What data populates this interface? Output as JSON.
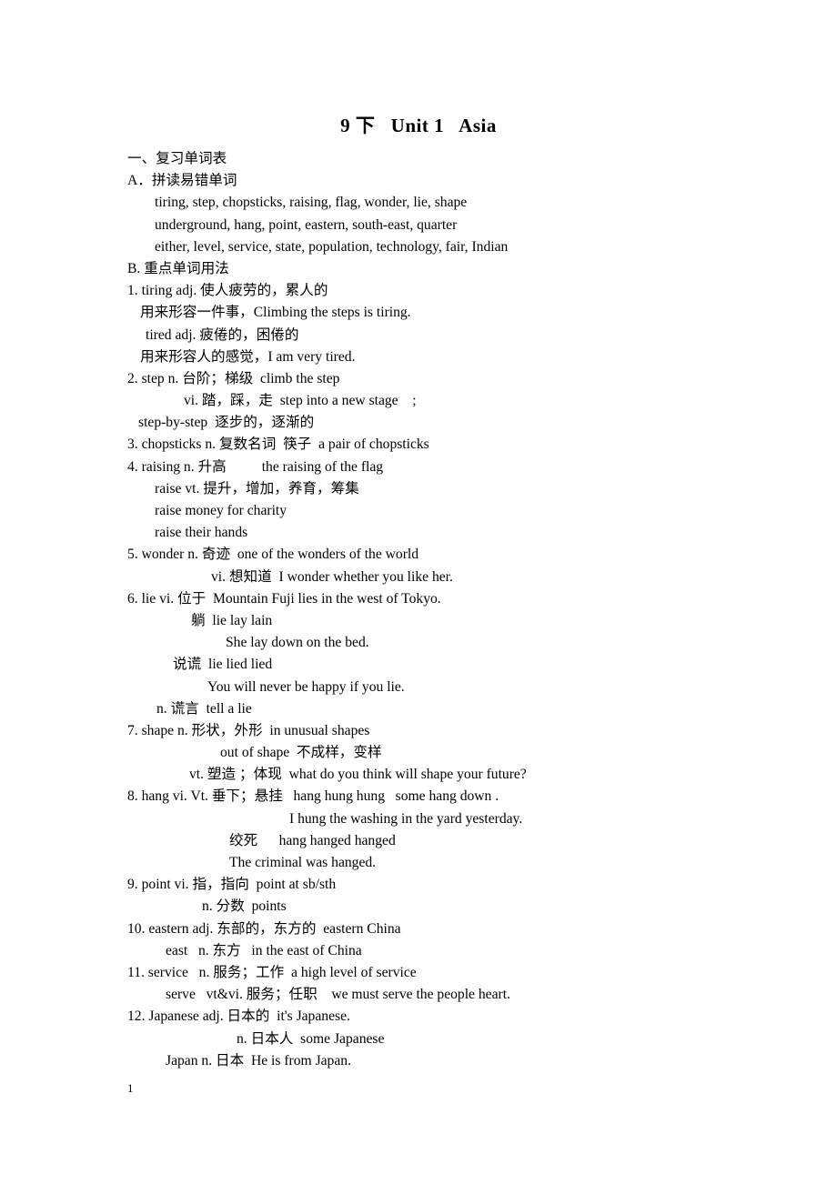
{
  "document": {
    "title": "9 下   Unit 1   Asia",
    "page_number": "1",
    "sections": [
      {
        "indent": 0,
        "text": "一、复习单词表"
      },
      {
        "indent": 0,
        "text": "A．拼读易错单词"
      },
      {
        "indent": 30,
        "text": "tiring, step, chopsticks, raising, flag, wonder, lie, shape"
      },
      {
        "indent": 30,
        "text": "underground, hang, point, eastern, south-east, quarter"
      },
      {
        "indent": 30,
        "text": "either, level, service, state, population, technology, fair, Indian"
      },
      {
        "indent": 0,
        "text": "B. 重点单词用法"
      },
      {
        "indent": 0,
        "text": "1. tiring adj. 使人疲劳的，累人的"
      },
      {
        "indent": 14,
        "text": "用来形容一件事，Climbing the steps is tiring."
      },
      {
        "indent": 20,
        "text": "tired adj. 疲倦的，困倦的"
      },
      {
        "indent": 14,
        "text": "用来形容人的感觉，I am very tired."
      },
      {
        "indent": 0,
        "text": "2. step n. 台阶；梯级  climb the step"
      },
      {
        "indent": 62,
        "text": "vi. 踏，踩，走  step into a new stage    ;"
      },
      {
        "indent": 12,
        "text": "step-by-step  逐步的，逐渐的"
      },
      {
        "indent": 0,
        "text": "3. chopsticks n. 复数名词  筷子  a pair of chopsticks"
      },
      {
        "indent": 0,
        "text": "4. raising n. 升高          the raising of the flag"
      },
      {
        "indent": 30,
        "text": "raise vt. 提升，增加，养育，筹集"
      },
      {
        "indent": 30,
        "text": "raise money for charity"
      },
      {
        "indent": 30,
        "text": "raise their hands"
      },
      {
        "indent": 0,
        "text": "5. wonder n. 奇迹  one of the wonders of the world"
      },
      {
        "indent": 92,
        "text": "vi. 想知道  I wonder whether you like her."
      },
      {
        "indent": 0,
        "text": "6. lie vi. 位于  Mountain Fuji lies in the west of Tokyo."
      },
      {
        "indent": 70,
        "text": "躺  lie lay lain"
      },
      {
        "indent": 108,
        "text": "She lay down on the bed."
      },
      {
        "indent": 50,
        "text": "说谎  lie lied lied"
      },
      {
        "indent": 88,
        "text": "You will never be happy if you lie."
      },
      {
        "indent": 32,
        "text": "n. 谎言  tell a lie"
      },
      {
        "indent": 0,
        "text": "7. shape n. 形状，外形  in unusual shapes"
      },
      {
        "indent": 102,
        "text": "out of shape  不成样，变样"
      },
      {
        "indent": 68,
        "text": "vt. 塑造 ；体现  what do you think will shape your future?"
      },
      {
        "indent": 0,
        "text": "8. hang vi. Vt. 垂下；悬挂   hang hung hung   some hang down ."
      },
      {
        "indent": 178,
        "text": "I hung the washing in the yard yesterday."
      },
      {
        "indent": 112,
        "text": "绞死      hang hanged hanged"
      },
      {
        "indent": 112,
        "text": "The criminal was hanged."
      },
      {
        "indent": 0,
        "text": "9. point vi. 指，指向  point at sb/sth"
      },
      {
        "indent": 82,
        "text": "n. 分数  points"
      },
      {
        "indent": 0,
        "text": "10. eastern adj. 东部的，东方的  eastern China"
      },
      {
        "indent": 42,
        "text": "east   n. 东方   in the east of China"
      },
      {
        "indent": 0,
        "text": "11. service   n. 服务；工作  a high level of service"
      },
      {
        "indent": 42,
        "text": "serve   vt&vi. 服务；任职    we must serve the people heart."
      },
      {
        "indent": 0,
        "text": "12. Japanese adj. 日本的  it's Japanese."
      },
      {
        "indent": 120,
        "text": "n. 日本人  some Japanese"
      },
      {
        "indent": 42,
        "text": "Japan n. 日本  He is from Japan."
      }
    ]
  }
}
